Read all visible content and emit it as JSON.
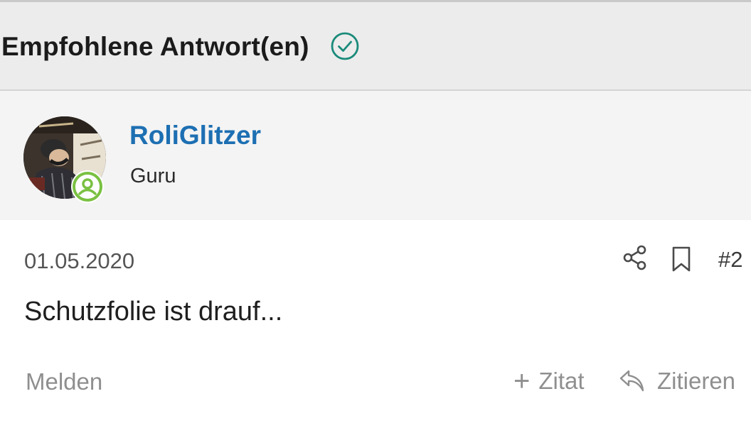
{
  "header": {
    "title": "Empfohlene Antwort(en)",
    "icon": "check-circle-icon",
    "accent_color": "#1a8a7a"
  },
  "author": {
    "name": "RoliGlitzer",
    "rank": "Guru",
    "avatar_icon": "user-avatar",
    "status_icon": "online-user-icon",
    "status_color": "#7ac142",
    "name_color": "#1d6fb2"
  },
  "post": {
    "date": "01.05.2020",
    "number": "#2",
    "body": "Schutzfolie ist drauf...",
    "share_icon": "share-icon",
    "bookmark_icon": "bookmark-icon"
  },
  "actions": {
    "report_label": "Melden",
    "quote_add_label": "Zitat",
    "quote_add_icon": "plus-icon",
    "reply_label": "Zitieren",
    "reply_icon": "reply-arrow-icon"
  }
}
